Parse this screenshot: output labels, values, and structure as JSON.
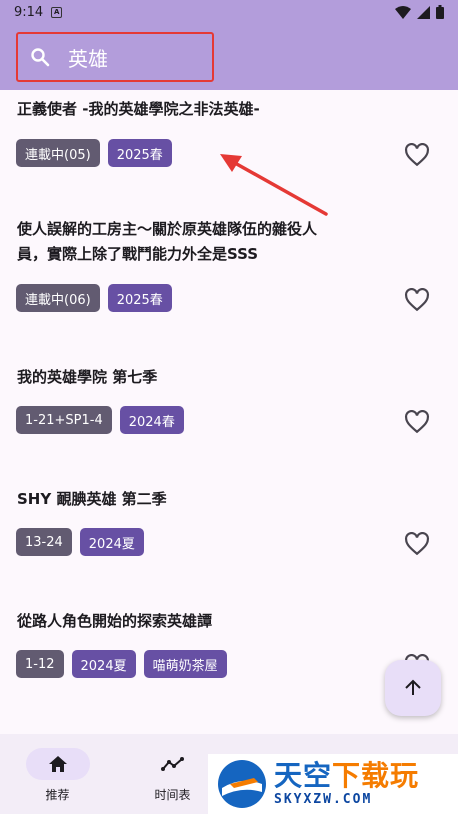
{
  "status_bar": {
    "time": "9:14",
    "notif_glyph": "A"
  },
  "search": {
    "query": "英雄"
  },
  "items": [
    {
      "title": "正義使者 -我的英雄學院之非法英雄-",
      "tags": [
        "連載中(05)",
        "2025春"
      ]
    },
    {
      "title": "使人誤解的工房主〜關於原英雄隊伍的雜役人員，實際上除了戰鬥能力外全是SSS",
      "tags": [
        "連載中(06)",
        "2025春"
      ]
    },
    {
      "title": "我的英雄學院 第七季",
      "tags": [
        "1-21+SP1-4",
        "2024春"
      ]
    },
    {
      "title": "SHY 靦腆英雄 第二季",
      "tags": [
        "13-24",
        "2024夏"
      ]
    },
    {
      "title": "從路人角色開始的探索英雄譚",
      "tags": [
        "1-12",
        "2024夏",
        "喵萌奶茶屋"
      ]
    }
  ],
  "bottom_nav": [
    {
      "label": "推荐",
      "icon": "home-icon"
    },
    {
      "label": "时间表",
      "icon": "timeline-icon"
    }
  ],
  "watermark": {
    "cn_blue": "天空",
    "cn_orange": "下载玩",
    "en": "SKYXZW.COM"
  },
  "colors": {
    "accent": "#b39ddb",
    "tag_gray": "#625b71",
    "tag_purple": "#6750a4",
    "annotation_red": "#e53935"
  }
}
